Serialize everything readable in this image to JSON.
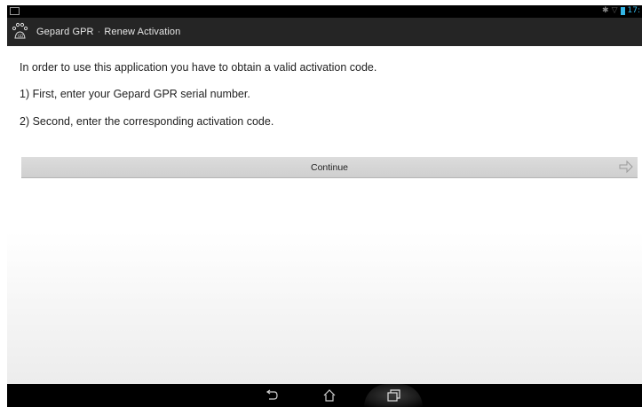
{
  "app": {
    "title": "Gepard GPR",
    "separator": "·",
    "subtitle": "Renew Activation",
    "icon": "paw-print-icon"
  },
  "status_bar": {
    "time": "17:",
    "icons": [
      "bluetooth-icon",
      "wifi-icon",
      "battery-icon"
    ]
  },
  "content": {
    "intro": "In order to use this application you have to obtain a valid activation code.",
    "step1": "1) First, enter your Gepard GPR serial number.",
    "step2": "2) Second, enter the corresponding activation code."
  },
  "continue_button": {
    "label": "Continue",
    "icon": "arrow-right-icon"
  },
  "nav_bar": {
    "buttons": [
      "back-icon",
      "home-icon",
      "recent-apps-icon"
    ]
  },
  "colors": {
    "action_bar": "#252525",
    "status_bar": "#000000",
    "accent": "#33b5e5",
    "button": "#d6d6d6"
  }
}
